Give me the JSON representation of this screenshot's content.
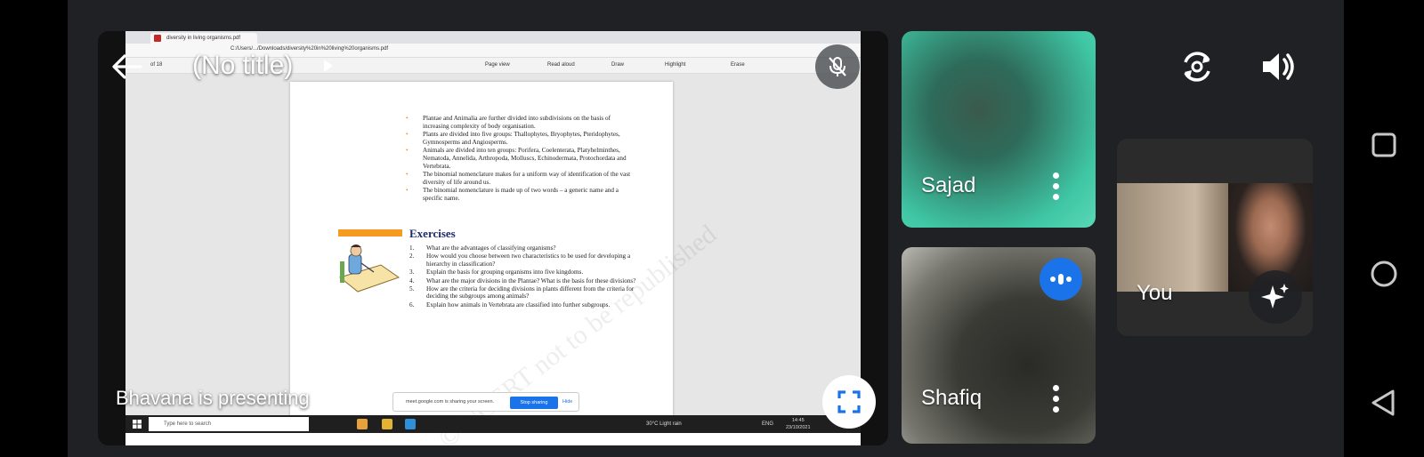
{
  "meeting": {
    "title": "(No title)",
    "presenter_label": "Bhavana is presenting"
  },
  "participants": [
    {
      "name": "Sajad"
    },
    {
      "name": "Shafiq"
    },
    {
      "name": "You"
    }
  ],
  "shared_screen": {
    "tab_title": "diversity in living organisms.pdf",
    "address": "C:/Users/.../Downloads/diversity%20in%20living%20organisms.pdf",
    "page_indicator": "of 18",
    "toolbar": {
      "page_view": "Page view",
      "read_aloud": "Read aloud",
      "draw": "Draw",
      "highlight": "Highlight",
      "erase": "Erase"
    },
    "summary_bullets": [
      "Plantae and Animalia are further divided into subdivisions on the basis of increasing complexity of body organisation.",
      "Plants are divided into five groups: Thallophytes, Bryophytes, Pteridophytes, Gymnosperms and Angiosperms.",
      "Animals are divided into ten groups: Porifera, Coelenterata, Platyhelminthes, Nematoda, Annelida, Arthropoda, Molluscs, Echinodermata, Protochordata and Vertebrata.",
      "The binomial nomenclature makes for a uniform way of identification of the vast diversity of life around us.",
      "The binomial nomenclature is made up of two words – a generic name and a specific name."
    ],
    "exercises_title": "Exercises",
    "exercises": [
      {
        "num": "1.",
        "text": "What are the advantages of classifying organisms?"
      },
      {
        "num": "2.",
        "text": "How would you choose between two characteristics to be used for developing a hierarchy in classification?"
      },
      {
        "num": "3.",
        "text": "Explain the basis for grouping organisms into five kingdoms."
      },
      {
        "num": "4.",
        "text": "What are the major divisions in the Plantae? What is the basis for these divisions?"
      },
      {
        "num": "5.",
        "text": "How are the criteria for deciding divisions in plants different from the criteria for deciding the subgroups among animals?"
      },
      {
        "num": "6.",
        "text": "Explain how animals in Vertebrata are classified into further subgroups."
      }
    ],
    "watermark": "© NCERT not to be republished",
    "share_bar": {
      "message": "meet.google.com is sharing your screen.",
      "stop": "Stop sharing",
      "hide": "Hide"
    },
    "taskbar": {
      "search_placeholder": "Type here to search",
      "weather": "30°C  Light rain",
      "lang": "ENG",
      "time": "14:45",
      "date": "23/10/2021"
    }
  },
  "icons": {
    "back": "arrow-left-icon",
    "mic": "mic-off-icon",
    "camera_switch": "camera-switch-icon",
    "speaker": "speaker-icon",
    "fullscreen": "fullscreen-icon",
    "effects": "sparkle-icon",
    "more": "more-vert-icon",
    "speaking": "audio-indicator-icon"
  },
  "colors": {
    "meet_bg": "#202124",
    "accent_blue": "#1a73e8",
    "exercise_orange": "#f49b20"
  }
}
